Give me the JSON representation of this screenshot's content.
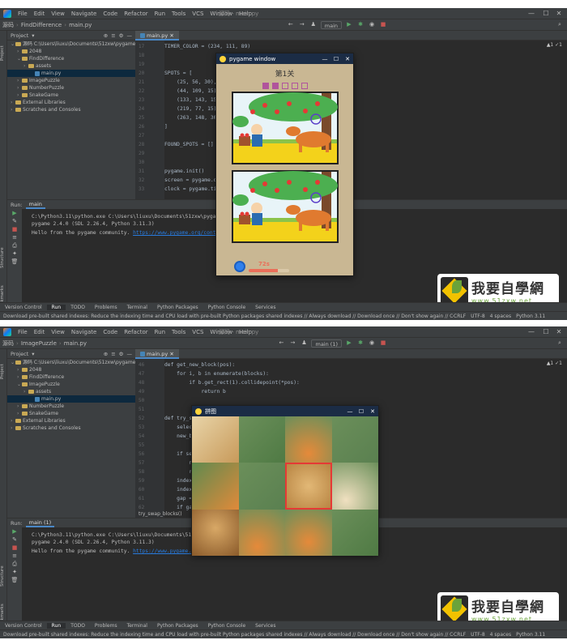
{
  "menu": [
    "File",
    "Edit",
    "View",
    "Navigate",
    "Code",
    "Refactor",
    "Run",
    "Tools",
    "VCS",
    "Window",
    "Help"
  ],
  "ide1": {
    "window_title": "源码 - main.py",
    "breadcrumb": [
      "源码",
      "FindDifference",
      "main.py"
    ],
    "run_config": "main",
    "project_header": "Project",
    "tree": [
      {
        "label": "源码  C:\\Users\\liuxu\\Documents\\51zxw\\pygame\\源码",
        "indent": 0,
        "type": "folder",
        "open": true
      },
      {
        "label": "2048",
        "indent": 1,
        "type": "folder",
        "open": false
      },
      {
        "label": "FindDifference",
        "indent": 1,
        "type": "folder",
        "open": true
      },
      {
        "label": "assets",
        "indent": 2,
        "type": "folder",
        "open": false
      },
      {
        "label": "main.py",
        "indent": 3,
        "type": "file",
        "selected": true
      },
      {
        "label": "ImagePuzzle",
        "indent": 1,
        "type": "folder",
        "open": false
      },
      {
        "label": "NumberPuzzle",
        "indent": 1,
        "type": "folder",
        "open": false
      },
      {
        "label": "SnakeGame",
        "indent": 1,
        "type": "folder",
        "open": false
      },
      {
        "label": "External Libraries",
        "indent": 0,
        "type": "folder",
        "open": false
      },
      {
        "label": "Scratches and Consoles",
        "indent": 0,
        "type": "folder",
        "open": false
      }
    ],
    "editor_tab": "main.py",
    "inspection": "▲1  ✓1",
    "lines": [
      {
        "no": "17",
        "code": "TIMER_COLOR = (234, 111, 89)"
      },
      {
        "no": "18",
        "code": ""
      },
      {
        "no": "19",
        "code": ""
      },
      {
        "no": "20",
        "code": "SPOTS = ["
      },
      {
        "no": "21",
        "code": "    (25, 56, 30),"
      },
      {
        "no": "22",
        "code": "    (44, 109, 15),"
      },
      {
        "no": "23",
        "code": "    (133, 143, 15),"
      },
      {
        "no": "24",
        "code": "    (219, 77, 15),"
      },
      {
        "no": "25",
        "code": "    (263, 148, 30)"
      },
      {
        "no": "26",
        "code": "]"
      },
      {
        "no": "27",
        "code": ""
      },
      {
        "no": "28",
        "code": "FOUND_SPOTS = []"
      },
      {
        "no": "29",
        "code": ""
      },
      {
        "no": "30",
        "code": ""
      },
      {
        "no": "31",
        "code": "pygame.init()"
      },
      {
        "no": "32",
        "code": "screen = pygame.display.set_mode"
      },
      {
        "no": "33",
        "code": "clock = pygame.time.Clock()"
      }
    ],
    "run_tab": "main",
    "console": [
      "C:\\Python3.11\\python.exe C:\\Users\\liuxu\\Documents\\51zxw\\pygame\\源码\\FindDifference\\main.py",
      "pygame 2.4.0 (SDL 2.26.4, Python 3.11.3)",
      "Hello from the pygame community. "
    ],
    "console_link": "https://www.pygame.org/contribute.html",
    "game": {
      "title": "pygame window",
      "level": "第1关",
      "found": 2,
      "total": 5,
      "timer": "72s",
      "timer_progress": 0.72
    }
  },
  "ide2": {
    "window_title": "源码 - main.py",
    "breadcrumb": [
      "源码",
      "ImagePuzzle",
      "main.py"
    ],
    "run_config": "main (1)",
    "project_header": "Project",
    "tree": [
      {
        "label": "源码  C:\\Users\\liuxu\\Documents\\51zxw\\pygame\\源码",
        "indent": 0,
        "type": "folder",
        "open": true
      },
      {
        "label": "2048",
        "indent": 1,
        "type": "folder",
        "open": false
      },
      {
        "label": "FindDifference",
        "indent": 1,
        "type": "folder",
        "open": false
      },
      {
        "label": "ImagePuzzle",
        "indent": 1,
        "type": "folder",
        "open": true
      },
      {
        "label": "assets",
        "indent": 2,
        "type": "folder",
        "open": false
      },
      {
        "label": "main.py",
        "indent": 3,
        "type": "file",
        "selected": true
      },
      {
        "label": "NumberPuzzle",
        "indent": 1,
        "type": "folder",
        "open": false
      },
      {
        "label": "SnakeGame",
        "indent": 1,
        "type": "folder",
        "open": false
      },
      {
        "label": "External Libraries",
        "indent": 0,
        "type": "folder",
        "open": false
      },
      {
        "label": "Scratches and Consoles",
        "indent": 0,
        "type": "folder",
        "open": false
      }
    ],
    "editor_tab": "main.py",
    "inspection": "▲1  ✓1",
    "lines": [
      {
        "no": "46",
        "code": "def get_new_block(pos):"
      },
      {
        "no": "47",
        "code": "    for i, b in enumerate(blocks):"
      },
      {
        "no": "48",
        "code": "        if b.get_rect(1).collidepoint(*pos):"
      },
      {
        "no": "49",
        "code": "            return b"
      },
      {
        "no": "50",
        "code": ""
      },
      {
        "no": "51",
        "code": ""
      },
      {
        "no": "52",
        "code": "def try_swap_blocks():"
      },
      {
        "no": "53",
        "code": "    selected"
      },
      {
        "no": "54",
        "code": "    new_bl"
      },
      {
        "no": "55",
        "code": ""
      },
      {
        "no": "56",
        "code": "    if sel"
      },
      {
        "no": "57",
        "code": "        ne"
      },
      {
        "no": "58",
        "code": "        re"
      },
      {
        "no": "59",
        "code": "    index_"
      },
      {
        "no": "60",
        "code": "    index_"
      },
      {
        "no": "61",
        "code": "    gap = "
      },
      {
        "no": "62",
        "code": "    if gap"
      }
    ],
    "editor_footer": "try_swap_blocks()",
    "run_tab": "main (1)",
    "console": [
      "C:\\Python3.11\\python.exe C:\\Users\\liuxu\\Documents\\51zxw\\pygame\\源码\\ImagePuzzle\\main.py",
      "pygame 2.4.0 (SDL 2.26.4, Python 3.11.3)",
      "Hello from the pygame community. "
    ],
    "console_link": "https://www.pygame.org/contribute.html",
    "game": {
      "title": "拼图"
    }
  },
  "toolwindows": [
    "Version Control",
    "Run",
    "TODO",
    "Problems",
    "Terminal",
    "Python Packages",
    "Python Console",
    "Services"
  ],
  "status_message": "Download pre-built shared indexes: Reduce the indexing time and CPU load with pre-built Python packages shared indexes // Always download // Download once // Don't show again // Configure... (a minute ago)",
  "status_right": [
    "CRLF",
    "UTF-8",
    "4 spaces",
    "Python 3.11"
  ],
  "watermark": {
    "main": "我要自學網",
    "url": "www.51zxw.net"
  },
  "left_tabs": [
    "Project",
    "Structure",
    "Bookmarks"
  ],
  "colors": {
    "spot_found": "#b0549c",
    "timer": "#ea6f59",
    "title_bar": "#1b2c45"
  }
}
